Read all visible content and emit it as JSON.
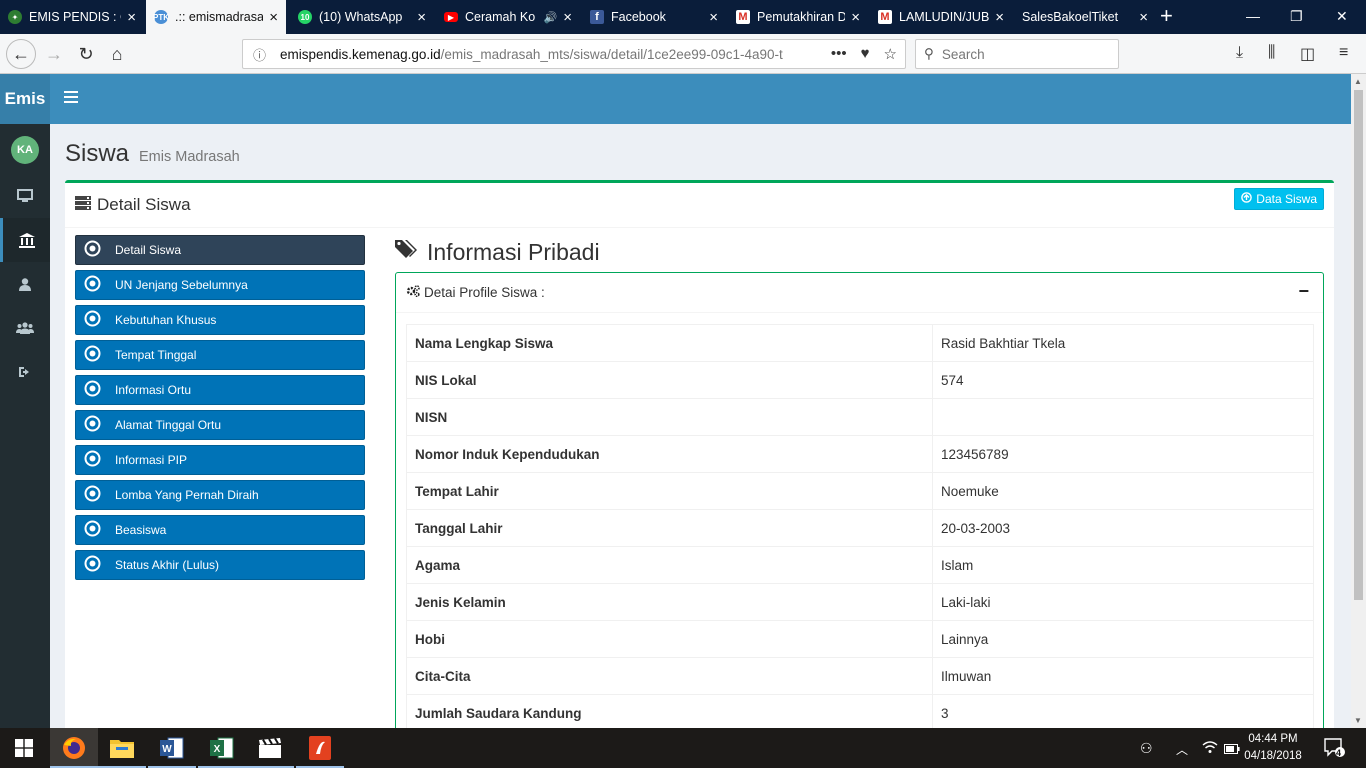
{
  "browser": {
    "tabs": [
      {
        "title": "EMIS PENDIS : C",
        "favicon": "emis-icon",
        "color": "#2e7d32"
      },
      {
        "title": ".:: emismadrasah",
        "favicon": "ptk-icon",
        "color": "#4a8fd6",
        "favicon_text": "PTK"
      },
      {
        "title": "(10) WhatsApp",
        "favicon": "whatsapp-icon",
        "color": "#25d366",
        "favicon_text": "10"
      },
      {
        "title": "Ceramah Ko",
        "favicon": "youtube-icon",
        "color": "#ff0000"
      },
      {
        "title": "Facebook",
        "favicon": "facebook-icon",
        "color": "#3b5998",
        "favicon_text": "f"
      },
      {
        "title": "Pemutakhiran D",
        "favicon": "gmail-icon",
        "color": "#d93025"
      },
      {
        "title": "LAMLUDIN/JUB",
        "favicon": "gmail-icon",
        "color": "#d93025"
      },
      {
        "title": "SalesBakoelTiket",
        "favicon": "none"
      }
    ],
    "url_domain": "emispendis.kemenag.go.id",
    "url_path": "/emis_madrasah_mts/siswa/detail/1ce2ee99-09c1-4a90-t",
    "search_placeholder": "Search"
  },
  "app": {
    "logo": "Emis",
    "avatar_initials": "KA",
    "page_title": "Siswa",
    "page_subtitle": "Emis Madrasah",
    "box_title": "Detail Siswa",
    "data_siswa_button": "Data Siswa",
    "menu": [
      {
        "label": "Detail Siswa",
        "active": true
      },
      {
        "label": "UN Jenjang Sebelumnya"
      },
      {
        "label": "Kebutuhan Khusus"
      },
      {
        "label": "Tempat Tinggal"
      },
      {
        "label": "Informasi Ortu"
      },
      {
        "label": "Alamat Tinggal Ortu"
      },
      {
        "label": "Informasi PIP"
      },
      {
        "label": "Lomba Yang Pernah Diraih"
      },
      {
        "label": "Beasiswa"
      },
      {
        "label": "Status Akhir (Lulus)"
      }
    ],
    "section_title": "Informasi Pribadi",
    "profile_header": "Detai Profile Siswa :",
    "profile": [
      {
        "key": "Nama Lengkap Siswa",
        "value": "Rasid Bakhtiar Tkela"
      },
      {
        "key": "NIS Lokal",
        "value": "574"
      },
      {
        "key": "NISN",
        "value": ""
      },
      {
        "key": "Nomor Induk Kependudukan",
        "value": "123456789"
      },
      {
        "key": "Tempat Lahir",
        "value": "Noemuke"
      },
      {
        "key": "Tanggal Lahir",
        "value": "20-03-2003"
      },
      {
        "key": "Agama",
        "value": "Islam"
      },
      {
        "key": "Jenis Kelamin",
        "value": "Laki-laki"
      },
      {
        "key": "Hobi",
        "value": "Lainnya"
      },
      {
        "key": "Cita-Cita",
        "value": "Ilmuwan"
      },
      {
        "key": "Jumlah Saudara Kandung",
        "value": "3"
      }
    ]
  },
  "taskbar": {
    "time": "04:44 PM",
    "date": "04/18/2018",
    "notifications": "4"
  },
  "colors": {
    "header": "#3c8dbc",
    "sidebar": "#222d32",
    "menu_item": "#0073b7",
    "box_border": "#00a65a",
    "button": "#00c0ef"
  }
}
